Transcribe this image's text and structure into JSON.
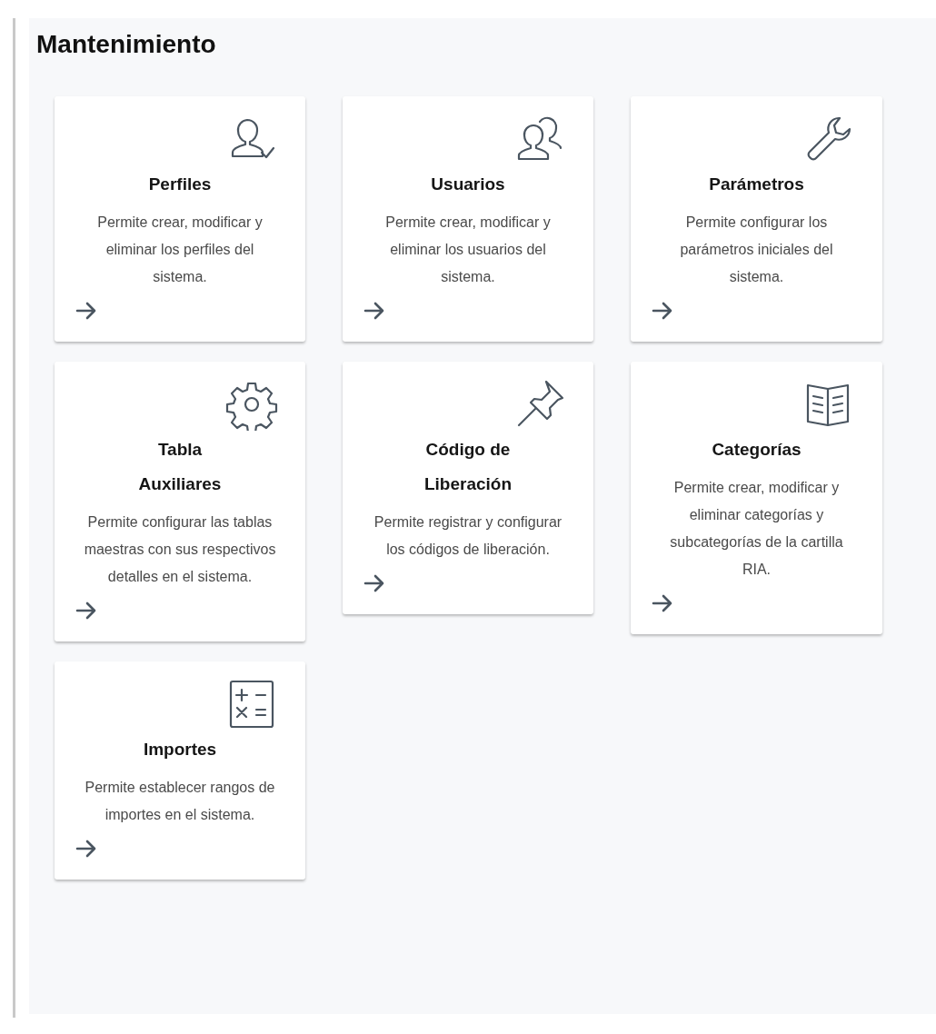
{
  "title": "Mantenimiento",
  "cards": [
    {
      "kind": "user-check",
      "title": "Perfiles",
      "description": "Permite crear, modificar y eliminar los perfiles del sistema."
    },
    {
      "kind": "users",
      "title": "Usuarios",
      "description": "Permite crear, modificar y eliminar los usuarios del sistema."
    },
    {
      "kind": "wrench",
      "title": "Parámetros",
      "description": "Permite configurar los parámetros iniciales del sistema."
    },
    {
      "kind": "gear",
      "title": "Tabla Auxiliares",
      "description": "Permite configurar las tablas maestras con sus respectivos detalles en el sistema."
    },
    {
      "kind": "pin",
      "title": "Código de Liberación",
      "description": "Permite registrar y configurar los códigos de liberación."
    },
    {
      "kind": "book",
      "title": "Categorías",
      "description": "Permite crear, modificar y eliminar categorías y subcategorías de la cartilla RIA."
    },
    {
      "kind": "calculator",
      "title": "Importes",
      "description": "Permite establecer rangos de importes en el sistema."
    }
  ]
}
